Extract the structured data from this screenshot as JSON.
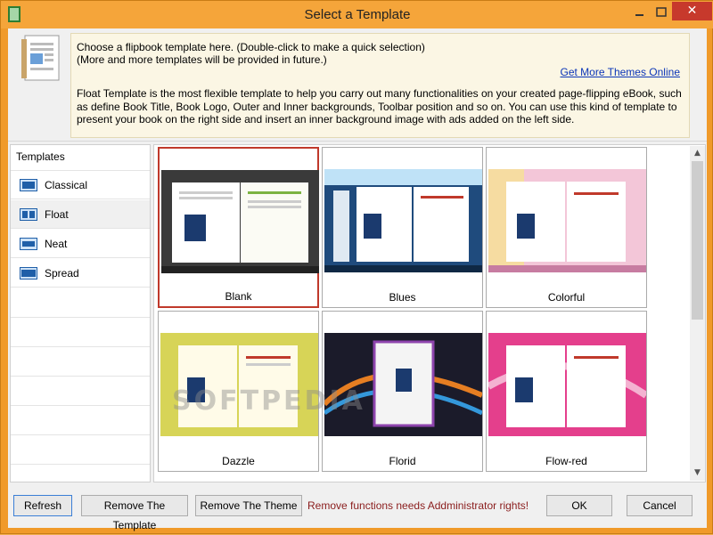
{
  "window": {
    "title": "Select a Template",
    "close_glyph": "✕"
  },
  "info": {
    "line1": "Choose a flipbook template here. (Double-click to make a quick selection)",
    "line2": "(More and more templates will be provided in future.)",
    "more_link": "Get More Themes Online",
    "description": "Float Template is the most flexible template to help you carry out many functionalities on your created page-flipping eBook, such as define Book Title, Book Logo, Outer and Inner backgrounds, Toolbar position and so on. You can use this kind of template to present your book on the right side and insert an inner background image with ads added on the left side."
  },
  "left_panel": {
    "header": "Templates",
    "categories": [
      {
        "label": "Classical",
        "icon": "classical-template-icon",
        "selected": false
      },
      {
        "label": "Float",
        "icon": "float-template-icon",
        "selected": true
      },
      {
        "label": "Neat",
        "icon": "neat-template-icon",
        "selected": false
      },
      {
        "label": "Spread",
        "icon": "spread-template-icon",
        "selected": false
      }
    ]
  },
  "templates": [
    {
      "label": "Blank",
      "selected": true,
      "bg": "#3a3a3a"
    },
    {
      "label": "Blues",
      "selected": false,
      "bg": "#1f4b7d"
    },
    {
      "label": "Colorful",
      "selected": false,
      "bg": "#f3c6d8"
    },
    {
      "label": "Dazzle",
      "selected": false,
      "bg": "#d7d457"
    },
    {
      "label": "Florid",
      "selected": false,
      "bg": "#1b1b2a"
    },
    {
      "label": "Flow-red",
      "selected": false,
      "bg": "#e43f8c"
    }
  ],
  "buttons": {
    "refresh": "Refresh",
    "remove_template": "Remove The Template",
    "remove_theme": "Remove The Theme",
    "ok": "OK",
    "cancel": "Cancel"
  },
  "warning": "Remove functions needs Addministrator rights!",
  "watermark": "SOFTPEDIA",
  "colors": {
    "titlebar": "#f5a53a",
    "selection_border": "#c0392b",
    "link": "#0a35b8",
    "warning": "#8a1c1c"
  }
}
